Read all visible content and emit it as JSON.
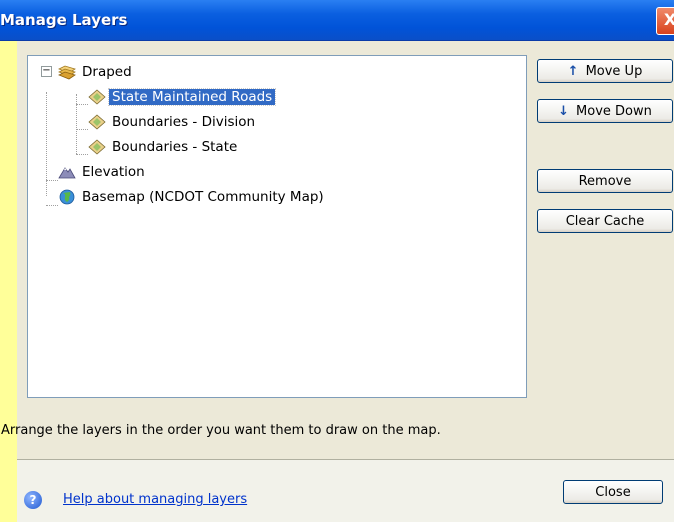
{
  "window": {
    "title": "Manage Layers",
    "close_glyph": "X"
  },
  "tree": {
    "expander_glyph": "−",
    "nodes": [
      {
        "label": "Draped",
        "icon": "folder-layers-icon"
      },
      {
        "label": "State Maintained Roads",
        "icon": "layer-diamond-icon",
        "selected": true
      },
      {
        "label": "Boundaries - Division",
        "icon": "layer-diamond-icon"
      },
      {
        "label": "Boundaries - State",
        "icon": "layer-diamond-icon"
      },
      {
        "label": "Elevation",
        "icon": "mountain-icon"
      },
      {
        "label": "Basemap (NCDOT Community Map)",
        "icon": "globe-icon"
      }
    ]
  },
  "buttons": {
    "move_up": "Move Up",
    "move_up_icon": "↑",
    "move_down": "Move Down",
    "move_down_icon": "↓",
    "remove": "Remove",
    "clear_cache": "Clear Cache",
    "close": "Close"
  },
  "instructions": "Arrange the layers in the order you want them to draw on the map.",
  "footer": {
    "help_icon": "?",
    "help_link": "Help about managing layers"
  },
  "colors": {
    "selection": "#316AC5",
    "link": "#0033CC",
    "titlebar": "#0153D8"
  }
}
